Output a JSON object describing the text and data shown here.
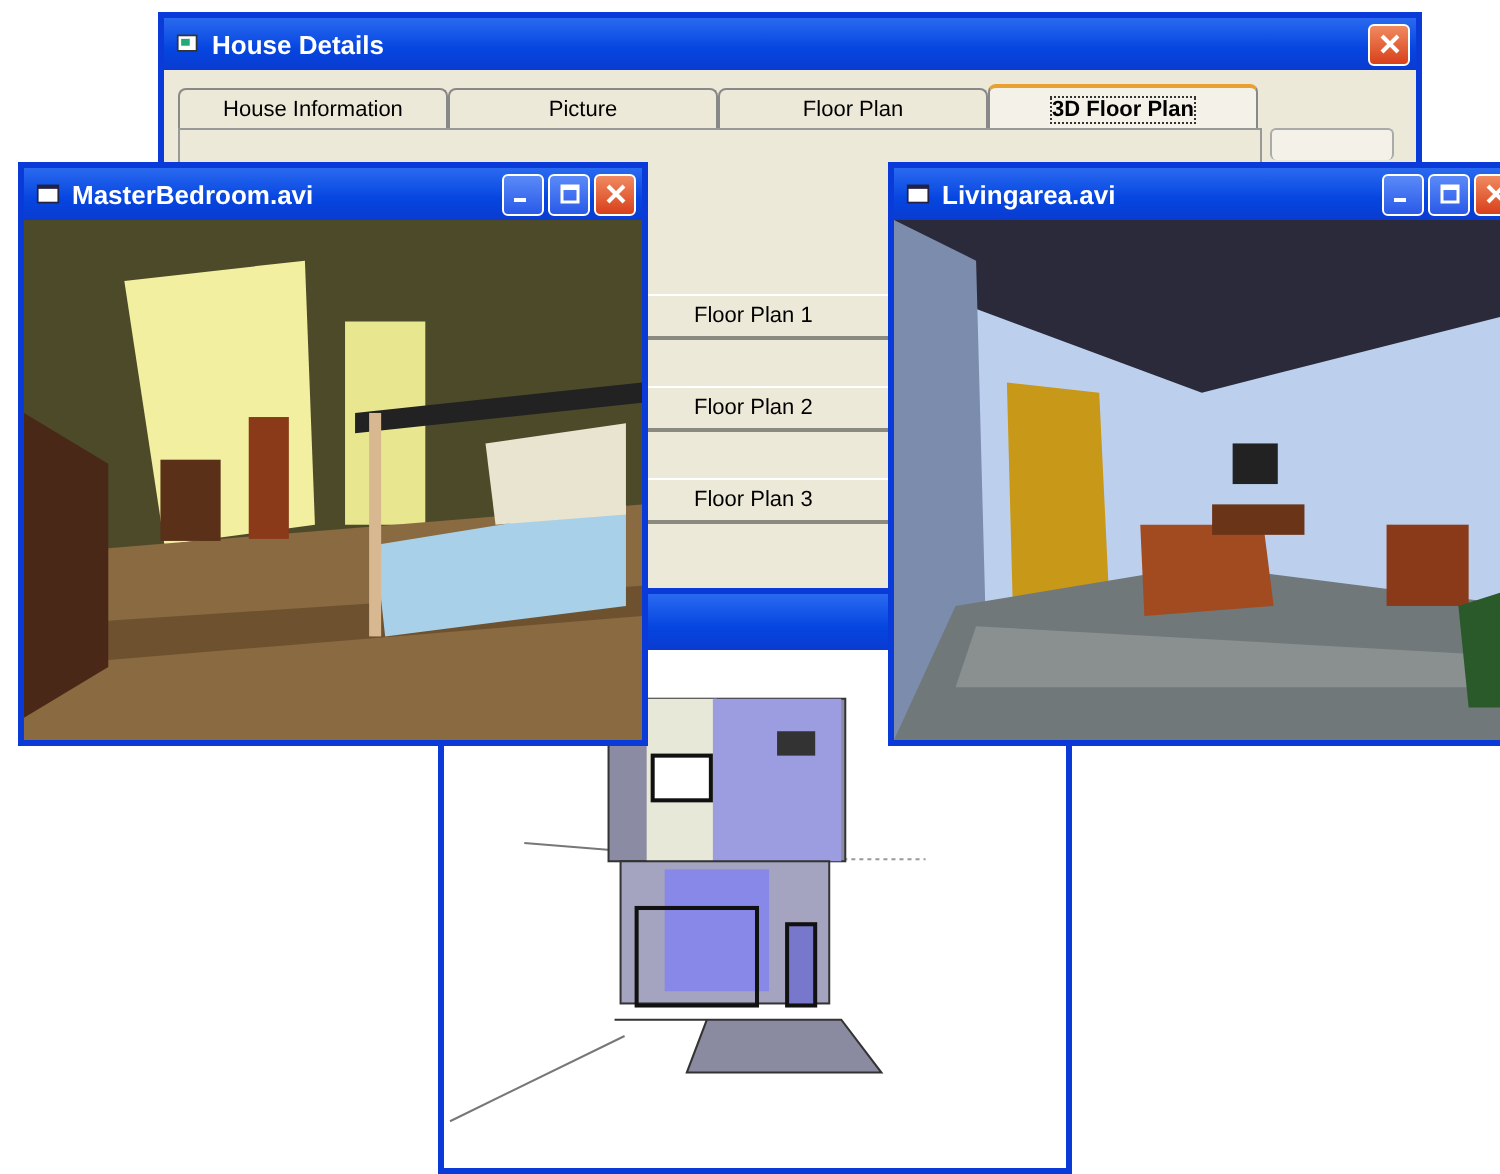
{
  "house_window": {
    "title": "House Details",
    "tabs": [
      {
        "label": "House Information",
        "selected": false
      },
      {
        "label": "Picture",
        "selected": false
      },
      {
        "label": "Floor Plan",
        "selected": false
      },
      {
        "label": "3D Floor Plan",
        "selected": true
      }
    ],
    "buttons": [
      "Floor Plan 1",
      "Floor Plan 2",
      "Floor Plan 3"
    ]
  },
  "video_windows": [
    {
      "title": "MasterBedroom.avi"
    },
    {
      "title": "Livingarea.avi"
    }
  ]
}
